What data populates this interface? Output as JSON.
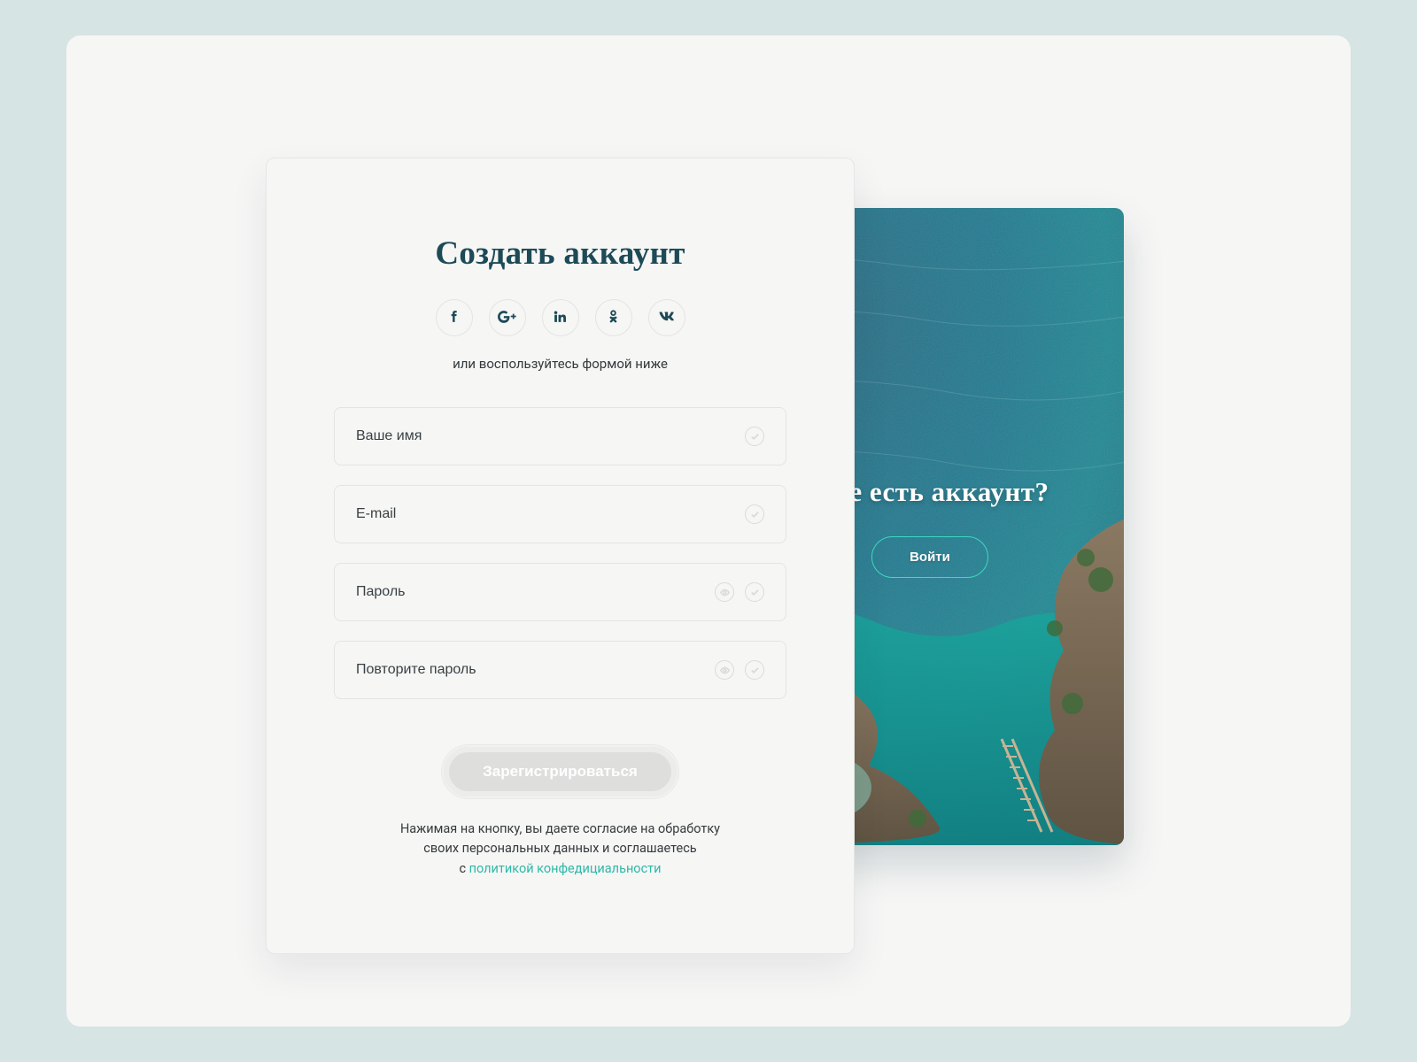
{
  "form": {
    "title": "Создать аккаунт",
    "subtitle": "или воспользуйтесь формой ниже",
    "socials": {
      "facebook": "facebook-icon",
      "google_plus": "google-plus-icon",
      "linkedin": "linkedin-icon",
      "odnoklassniki": "odnoklassniki-icon",
      "vk": "vk-icon"
    },
    "fields": {
      "name": {
        "placeholder": "Ваше имя"
      },
      "email": {
        "placeholder": "E-mail"
      },
      "password": {
        "placeholder": "Пароль"
      },
      "password_repeat": {
        "placeholder": "Повторите пароль"
      }
    },
    "submit_label": "Зарегистрироваться",
    "legal": {
      "line1": "Нажимая на кнопку, вы даете согласие на обработку",
      "line2": "своих персональных данных и соглашаетесь",
      "prefix": "c ",
      "link": "политикой конфедициальности"
    }
  },
  "hero": {
    "title": "Уже есть аккаунт?",
    "cta": "Войти"
  },
  "icons": {
    "validate": "check-circle-icon",
    "reveal": "eye-icon"
  },
  "colors": {
    "page_bg": "#d6e4e3",
    "surface": "#f6f6f5",
    "text_dark": "#1d4a57",
    "accent": "#3dd9c1",
    "link": "#2fb9a8",
    "button_disabled": "#dedfdc"
  }
}
